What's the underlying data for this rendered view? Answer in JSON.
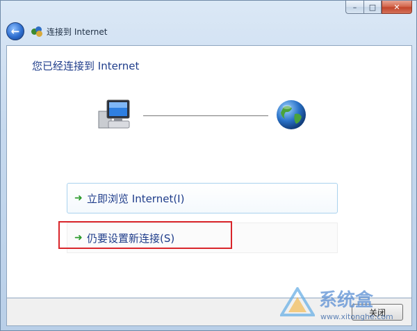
{
  "window": {
    "nav_title": "连接到 Internet"
  },
  "caption": {
    "minimize": "–",
    "maximize": "□",
    "close": "✕"
  },
  "content": {
    "heading": "您已经连接到 Internet",
    "commands": [
      {
        "label": "立即浏览 Internet(I)",
        "icon": "green-arrow-icon"
      },
      {
        "label": "仍要设置新连接(S)",
        "icon": "green-arrow-icon"
      }
    ]
  },
  "footer": {
    "close_button": "关闭"
  },
  "watermark": {
    "text": "系统盒",
    "url": "www.xitonghe.com"
  },
  "colors": {
    "link_blue": "#1e3c8a",
    "highlight_red": "#d9252a",
    "arrow_green": "#2a9a2a"
  }
}
